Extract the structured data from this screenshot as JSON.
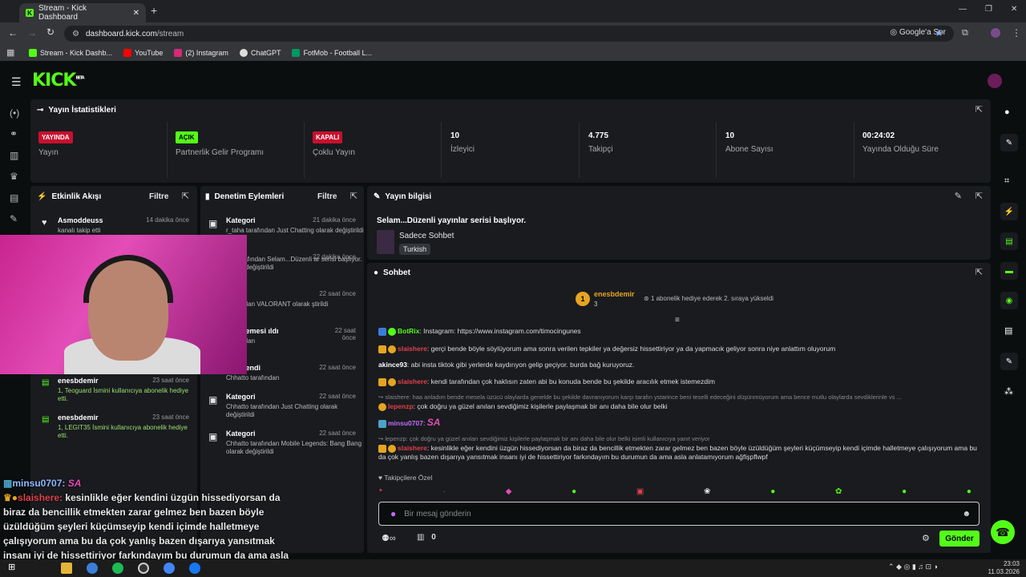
{
  "browser": {
    "tab_title": "Stream - Kick Dashboard",
    "url_host": "dashboard.kick.com",
    "url_path": "/stream",
    "google_btn": "Google'a Sor",
    "bookmarks": [
      "Stream - Kick Dashb...",
      "YouTube",
      "(2) Instagram",
      "ChatGPT",
      "FotMob - Football L..."
    ]
  },
  "header": {
    "logo": "KICK",
    "beta": "BETA"
  },
  "stats": {
    "title": "Yayın İstatistikleri",
    "items": [
      {
        "badge": "YAYINDA",
        "label": "Yayın",
        "badge_color": "#c8102e"
      },
      {
        "badge": "AÇIK",
        "label": "Partnerlik Gelir Programı",
        "badge_color": "#53fc18"
      },
      {
        "badge": "KAPALI",
        "label": "Çoklu Yayın",
        "badge_color": "#c8102e"
      },
      {
        "value": "10",
        "label": "İzleyici"
      },
      {
        "value": "4.775",
        "label": "Takipçi"
      },
      {
        "value": "10",
        "label": "Abone Sayısı"
      },
      {
        "value": "00:24:02",
        "label": "Yayında Olduğu Süre"
      }
    ]
  },
  "activity": {
    "title": "Etkinlik Akışı",
    "filter": "Filtre",
    "items": [
      {
        "name": "Asmoddeuss",
        "time": "14 dakika önce",
        "desc": "kanalı takip etti"
      },
      {
        "name": "enesbdemir",
        "time": "23 saat önce",
        "desc": "1, Teoguard İsmini kullanıcıya abonelik hediye etti."
      },
      {
        "name": "enesbdemir",
        "time": "23 saat önce",
        "desc": "1, LEGIT35 İsmini kullanıcıya abonelik hediye etti."
      }
    ]
  },
  "moderation": {
    "title": "Denetim Eylemleri",
    "filter": "Filtre",
    "items": [
      {
        "name": "Kategori",
        "time": "21 dakika önce",
        "desc": "r_taha tarafından Just Chatting olarak değiştirildi"
      },
      {
        "name": "",
        "time": "22 dakika önce",
        "desc": "hin tarafından Selam...Düzenli ar serisi başlıyor. olarak değiştirildi"
      },
      {
        "name": "egori",
        "time": "22 saat önce",
        "desc": "tarafından VALORANT olarak ştirildi"
      },
      {
        "name": "Sabitlemesi ıldı",
        "time": "22 saat önce",
        "desc": "tarafından"
      },
      {
        "name": "Sabitlendi",
        "time": "22 saat önce",
        "desc": "Chhatto tarafından"
      },
      {
        "name": "Kategori",
        "time": "22 saat önce",
        "desc": "Chhatto tarafından Just Chatting olarak değiştirildi"
      },
      {
        "name": "Kategori",
        "time": "22 saat önce",
        "desc": "Chhatto tarafından Mobile Legends: Bang Bang olarak değiştirildi"
      }
    ]
  },
  "stream_info": {
    "title": "Yayın bilgisi",
    "stream_title": "Selam...Düzenli yayınlar serisi başlıyor.",
    "category": "Sadece Sohbet",
    "language": "Turkish"
  },
  "chat": {
    "title": "Sohbet",
    "pinned_user": "enesbdemir",
    "pinned_count": "3",
    "pinned_note": "1 abonelik hediye ederek 2. sıraya yükseldi",
    "messages": [
      {
        "user": "BotRix",
        "color": "#53fc18",
        "text": "Instagram: https://www.instagram.com/timocingunes"
      },
      {
        "user": "slaishere",
        "color": "#e0404b",
        "text": "gerçi bende böyle söylüyorum ama sonra verilen tepkiler ya değersiz hissettiriyor ya da yapmacık geliyor sonra niye anlattım oluyorum"
      },
      {
        "user": "akince93",
        "color": "#ffffff",
        "text": "abi insta tiktok gibi yerlerde kaydırıyon gelip geçiyor. burda bağ kuruyoruz."
      },
      {
        "user": "slaishere",
        "color": "#e0404b",
        "text": "kendi tarafından çok haklısın zaten abi bu konuda bende bu şekilde aracılık etmek istemezdim"
      },
      {
        "reply": "slaishere: haa anladım bende mesela üzücü olaylarda genelde bu şekilde davranıyorum karşı tarafın ystarince beni teselli edeceğini düşünmüyorum ama bence mutlu olaylarda sevdiklerinle vs ...",
        "user": "lepenzp",
        "color": "#e0404b",
        "text": "çok doğru ya güzel anıları sevdiğimiz kişilerle paylaşmak bir anı daha bile olur belki"
      },
      {
        "user": "minsu0707",
        "color": "#c26bff",
        "text": "SA"
      },
      {
        "reply": "lepenzp: çok doğru ya güzel anıları sevdiğimiz kişilerle paylaşmak bir anı daha bile olur belki isimli kullanıcıya yanıt veriyor",
        "user": "slaishere",
        "color": "#e0404b",
        "text": "kesinlikle eğer kendini üzgün hissediyorsan da biraz da bencillik etmekten zarar gelmez ben bazen böyle üzüldüğüm şeyleri küçümseyip kendi içimde halletmeye çalışıyorum ama bu da çok yanlış bazen dışarıya yansıtmak insanı iyi de hissettiriyor farkındayım bu durumun da ama asla anlatamıyorum ağfişpflwpf"
      }
    ],
    "followers_only": "Takipçilere Özel",
    "input_placeholder": "Bir mesaj gönderin",
    "send": "Gönder",
    "count": "0"
  },
  "overlay": {
    "user1": "minsu0707:",
    "sa": "SA",
    "user2": "slaishere:",
    "text": "kesinlikle eğer kendini üzgün hissediyorsan da biraz da bencillik etmekten zarar gelmez ben bazen böyle üzüldüğüm şeyleri küçümseyip kendi içimde halletmeye çalışıyorum ama bu da çok yanlış bazen dışarıya yansıtmak insanı iyi de hissettiriyor farkındayım bu durumun da ama asla anlatamıyorum ağfişpflwpf"
  },
  "taskbar": {
    "time": "23:03",
    "date": "11.03.2026"
  }
}
